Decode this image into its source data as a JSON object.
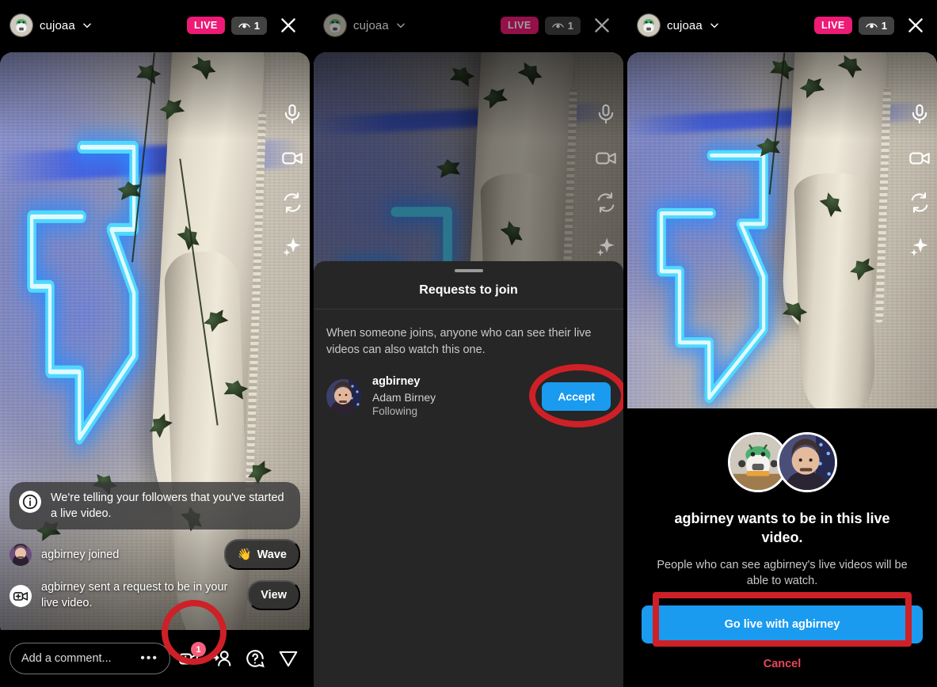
{
  "colors": {
    "live_badge": "#ED1B76",
    "accent_blue": "#1A9BF0",
    "annotation_red": "#CE2027",
    "cancel_red": "#E8465A",
    "sheet_bg": "#262626",
    "badge_pink": "#F4607B"
  },
  "stream": {
    "username": "cujoaa",
    "live_label": "LIVE",
    "viewer_count": "1",
    "avatar_icon": "robot-avatar",
    "chevron_icon": "chevron-down-icon",
    "close_icon": "close-icon"
  },
  "rail": {
    "items": [
      {
        "icon": "microphone-icon",
        "name": "mic-toggle"
      },
      {
        "icon": "video-camera-icon",
        "name": "camera-toggle"
      },
      {
        "icon": "flip-camera-icon",
        "name": "flip-camera"
      },
      {
        "icon": "sparkles-effects-icon",
        "name": "effects"
      }
    ]
  },
  "panel1": {
    "toast": {
      "icon": "info-icon",
      "text": "We're telling your followers that you've started a live video."
    },
    "events": [
      {
        "icon": "user-avatar",
        "text": "agbirney joined",
        "action_label": "Wave",
        "action_emoji": "👋",
        "action_name": "wave-button"
      },
      {
        "icon": "add-video-icon",
        "text": "agbirney sent a request to be in your live video.",
        "action_label": "View",
        "action_emoji": "",
        "action_name": "view-request-button"
      }
    ],
    "composer": {
      "placeholder": "Add a comment...",
      "more_icon": "ellipsis-icon",
      "icons": [
        {
          "icon": "add-to-live-video-icon",
          "name": "add-guest-button",
          "badge": "1"
        },
        {
          "icon": "add-person-icon",
          "name": "invite-person-button",
          "badge": ""
        },
        {
          "icon": "question-circle-icon",
          "name": "help-button",
          "badge": ""
        },
        {
          "icon": "send-icon",
          "name": "share-button",
          "badge": ""
        }
      ]
    }
  },
  "panel2": {
    "sheet": {
      "title": "Requests to join",
      "description": "When someone joins, anyone who can see their live videos can also watch this one.",
      "request": {
        "username": "agbirney",
        "full_name": "Adam Birney",
        "relationship": "Following",
        "accept_label": "Accept",
        "avatar_icon": "user-avatar"
      }
    }
  },
  "panel3": {
    "dialog": {
      "avatar_left_icon": "robot-avatar",
      "avatar_right_icon": "user-avatar",
      "title": "agbirney wants to be in this live video.",
      "subtitle": "People who can see agbirney's live videos will be able to watch.",
      "primary_label": "Go live with agbirney",
      "cancel_label": "Cancel"
    }
  }
}
